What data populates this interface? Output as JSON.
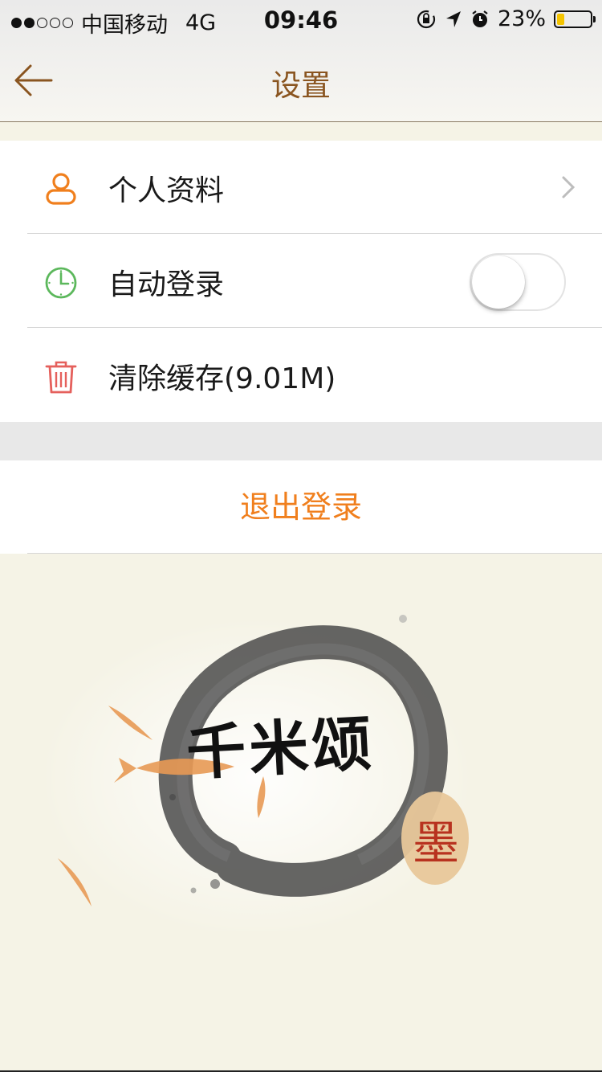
{
  "status_bar": {
    "signal_dots_filled": 2,
    "signal_dots_total": 5,
    "carrier": "中国移动",
    "network": "4G",
    "time": "09:46",
    "battery": "23%",
    "battery_level": 0.23,
    "icons": [
      "orientation-lock-icon",
      "location-icon",
      "alarm-icon"
    ]
  },
  "navbar": {
    "title": "设置",
    "back_icon": "back-arrow-icon",
    "accent_color": "#8a5520"
  },
  "settings": {
    "items": [
      {
        "label": "个人资料",
        "icon": "person-icon",
        "icon_color": "#f07f1d",
        "accessory": "chevron-right-icon"
      },
      {
        "label": "自动登录",
        "icon": "clock-icon",
        "icon_color": "#5cb85c",
        "accessory": "toggle",
        "toggle_on": false
      },
      {
        "label": "清除缓存(9.01M)",
        "icon": "trash-icon",
        "icon_color": "#e5605c",
        "accessory": "none"
      }
    ]
  },
  "logout": {
    "label": "退出登录",
    "color": "#f07f1d"
  },
  "logo": {
    "title": "千米颂",
    "seal": "墨"
  }
}
